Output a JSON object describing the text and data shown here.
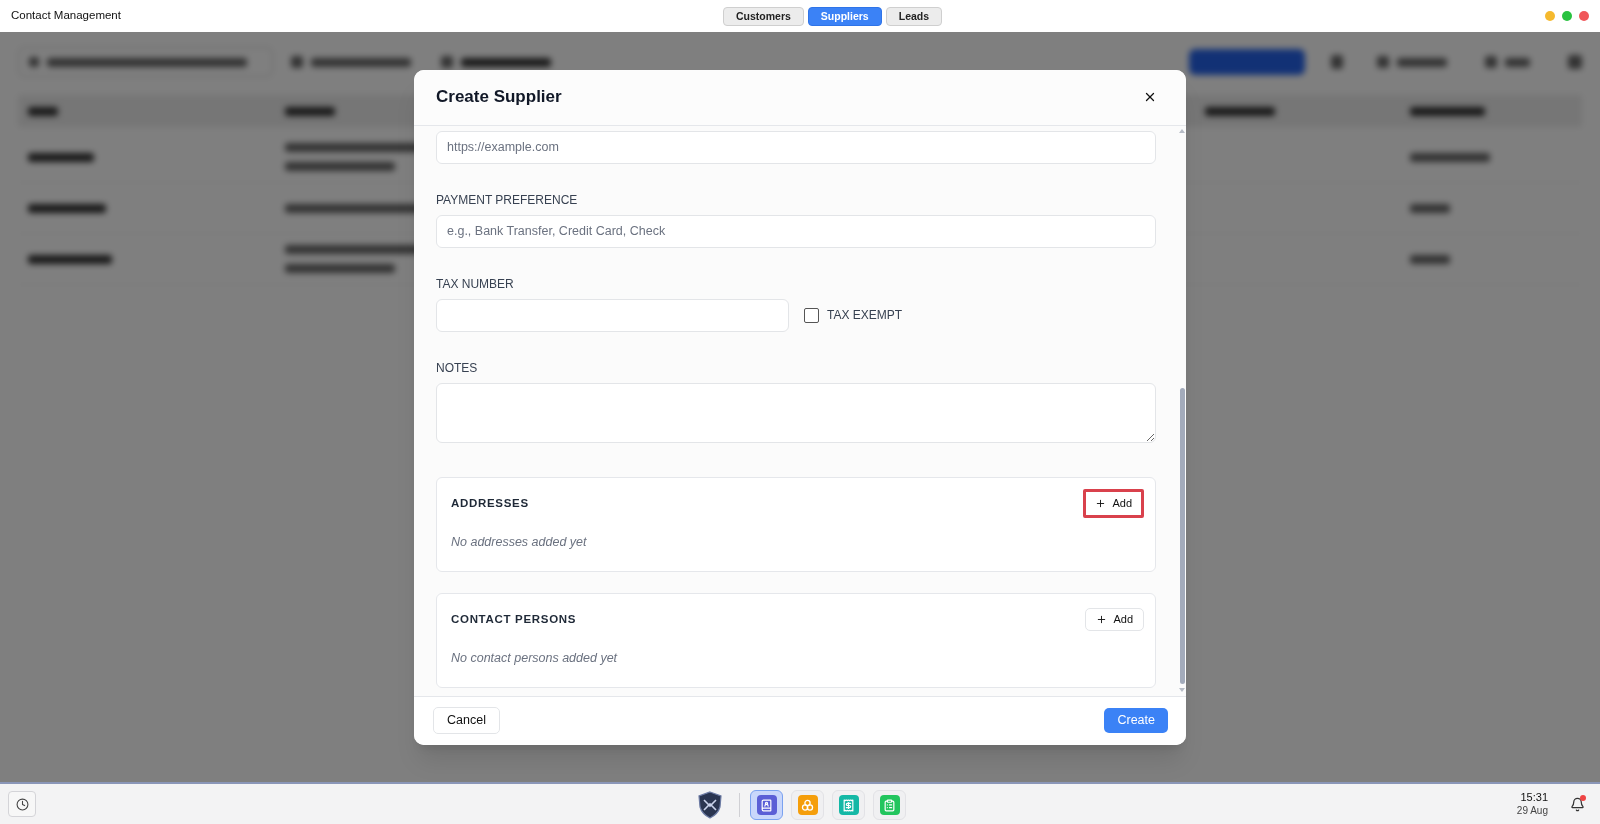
{
  "window": {
    "title": "Contact Management"
  },
  "tabs": [
    {
      "label": "Customers",
      "selected": false
    },
    {
      "label": "Suppliers",
      "selected": true
    },
    {
      "label": "Leads",
      "selected": false
    }
  ],
  "dialog": {
    "title": "Create Supplier",
    "fields": [
      {
        "kind": "input",
        "placeholder": "https://example.com"
      },
      {
        "kind": "input",
        "label": "PAYMENT PREFERENCE",
        "placeholder": "e.g., Bank Transfer, Credit Card, Check"
      },
      {
        "kind": "input_with_checkbox",
        "label": "TAX NUMBER",
        "checkbox_label": "TAX EXEMPT",
        "checked": false
      },
      {
        "kind": "textarea",
        "label": "NOTES"
      }
    ],
    "sections": [
      {
        "title": "ADDRESSES",
        "button": "Add",
        "highlighted": true,
        "empty_text": "No addresses added yet"
      },
      {
        "title": "CONTACT PERSONS",
        "button": "Add",
        "highlighted": false,
        "empty_text": "No contact persons added yet"
      }
    ],
    "footer_buttons": [
      {
        "kind": "secondary",
        "label": "Cancel"
      },
      {
        "kind": "primary",
        "label": "Create"
      }
    ]
  },
  "taskbar": {
    "apps": [
      {
        "kind": "contacts",
        "color": "#5b5fd6",
        "selected": true
      },
      {
        "kind": "rings",
        "color": "#f59e0b",
        "selected": false
      },
      {
        "kind": "invoice",
        "color": "#14b8a6",
        "selected": false
      },
      {
        "kind": "clipboard",
        "color": "#22c55e",
        "selected": false
      }
    ],
    "time": "15:31",
    "date": "29 Aug",
    "has_notification": true
  }
}
